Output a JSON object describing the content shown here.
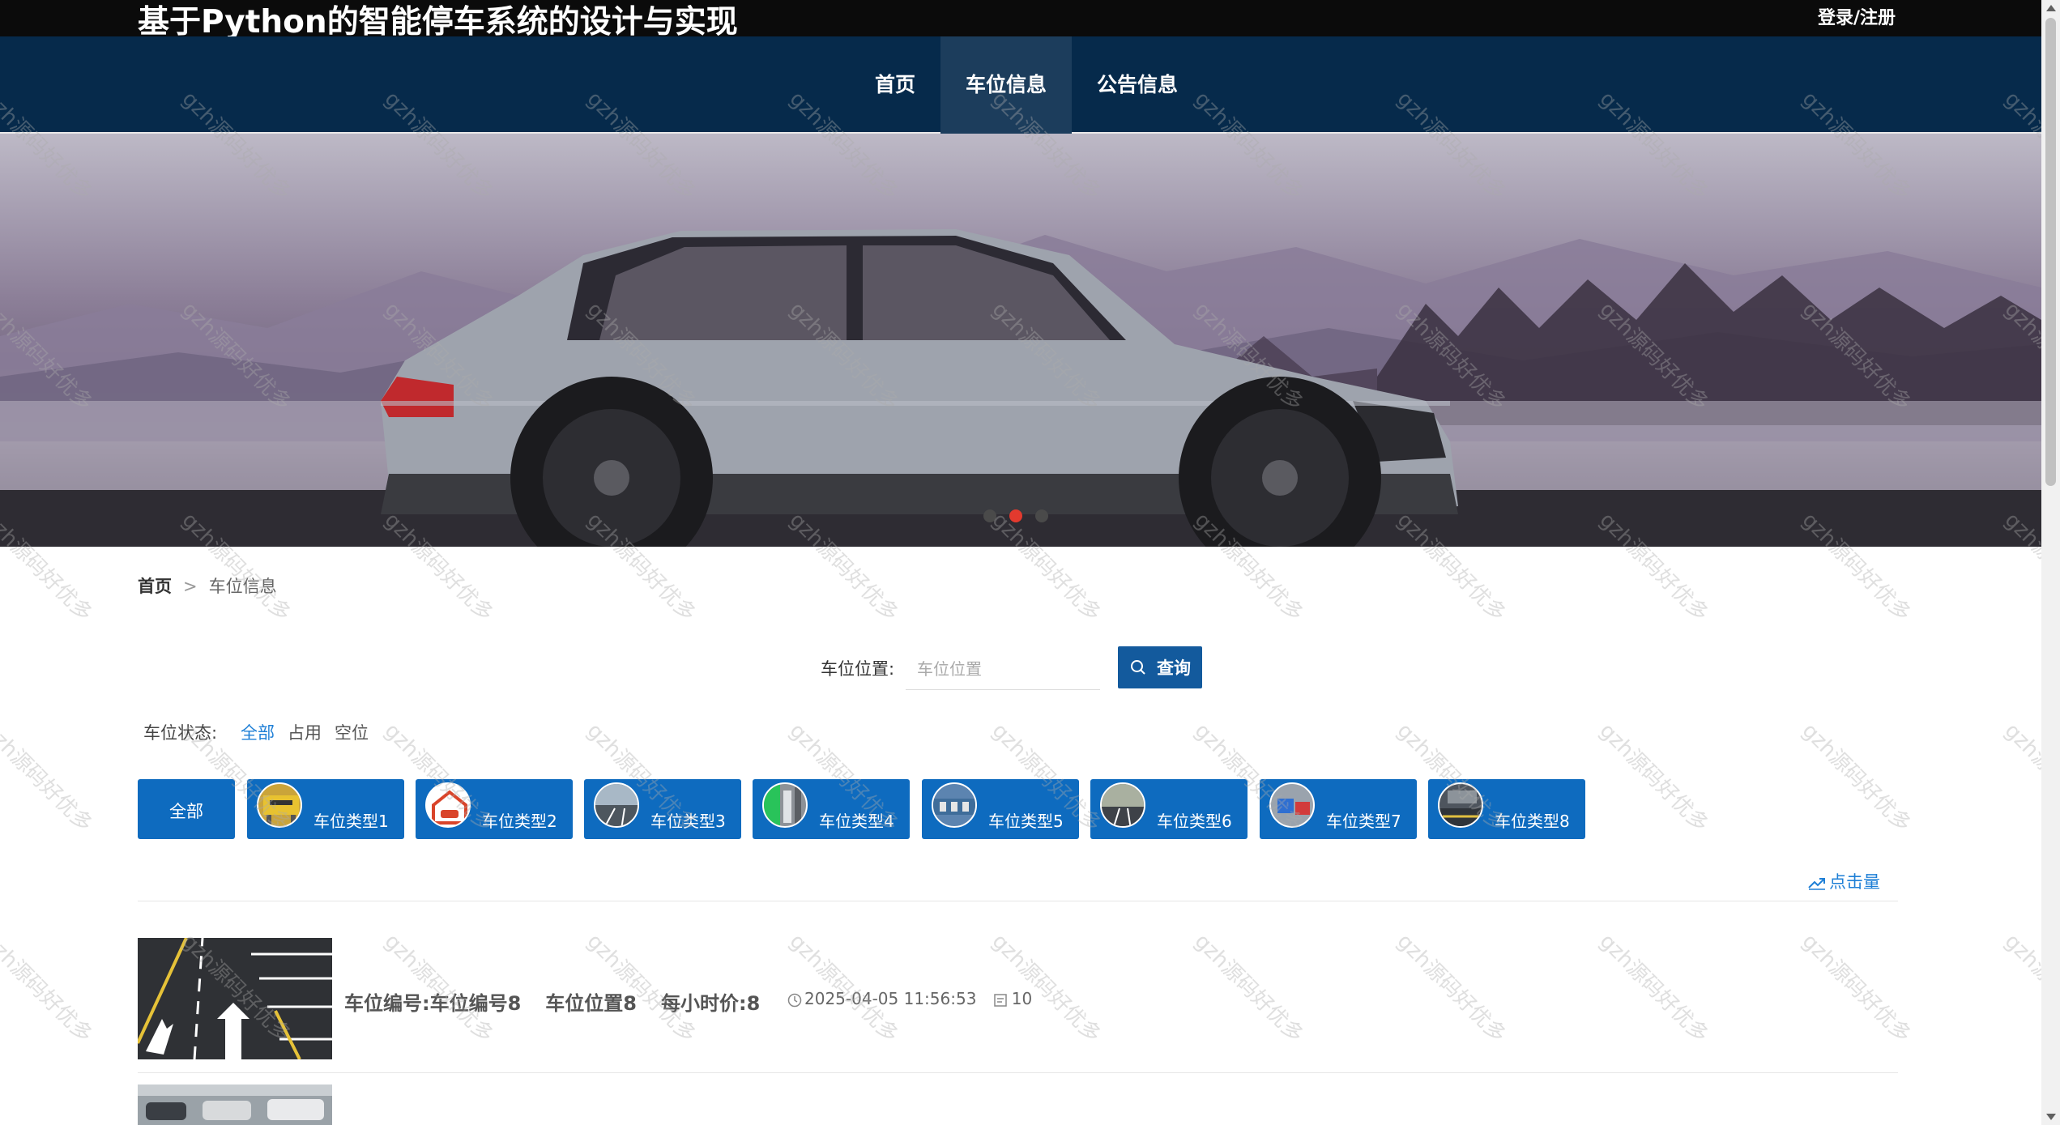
{
  "header": {
    "site_title": "基于Python的智能停车系统的设计与实现",
    "login_link": "登录/注册"
  },
  "nav": {
    "items": [
      {
        "label": "首页",
        "active": false
      },
      {
        "label": "车位信息",
        "active": true
      },
      {
        "label": "公告信息",
        "active": false
      }
    ]
  },
  "banner": {
    "slide_count": 3,
    "active_slide": 2
  },
  "breadcrumb": {
    "home": "首页",
    "separator": ">",
    "current": "车位信息"
  },
  "search": {
    "label": "车位位置:",
    "placeholder": "车位位置",
    "value": "",
    "button_label": "查询"
  },
  "status_filter": {
    "label": "车位状态:",
    "options": [
      "全部",
      "占用",
      "空位"
    ],
    "selected": "全部"
  },
  "type_filter": {
    "all_label": "全部",
    "types": [
      {
        "label": "车位类型1",
        "icon": "parking-sign-thumb"
      },
      {
        "label": "车位类型2",
        "icon": "garage-thumb"
      },
      {
        "label": "车位类型3",
        "icon": "lot-thumb"
      },
      {
        "label": "车位类型4",
        "icon": "ev-charging-thumb"
      },
      {
        "label": "车位类型5",
        "icon": "aerial-lot-thumb"
      },
      {
        "label": "车位类型6",
        "icon": "street-thumb"
      },
      {
        "label": "车位类型7",
        "icon": "marked-spot-thumb"
      },
      {
        "label": "车位类型8",
        "icon": "underground-thumb"
      }
    ]
  },
  "sort": {
    "click_count_label": "点击量"
  },
  "listings": [
    {
      "code_label": "车位编号:车位编号8",
      "location": "车位位置8",
      "hourly_price": "每小时价:8",
      "timestamp": "2025-04-05 11:56:53",
      "clicks": "10"
    }
  ],
  "watermark": {
    "text": "gzh源码好优多"
  },
  "colors": {
    "topbar_bg": "#0b0b0b",
    "nav_bg": "#062a4b",
    "nav_active_bg": "#1c3d5c",
    "accent_blue": "#0e6bbf",
    "search_button": "#135a9d",
    "link_blue": "#1e7fd6",
    "carousel_active_dot": "#e33a2e"
  }
}
